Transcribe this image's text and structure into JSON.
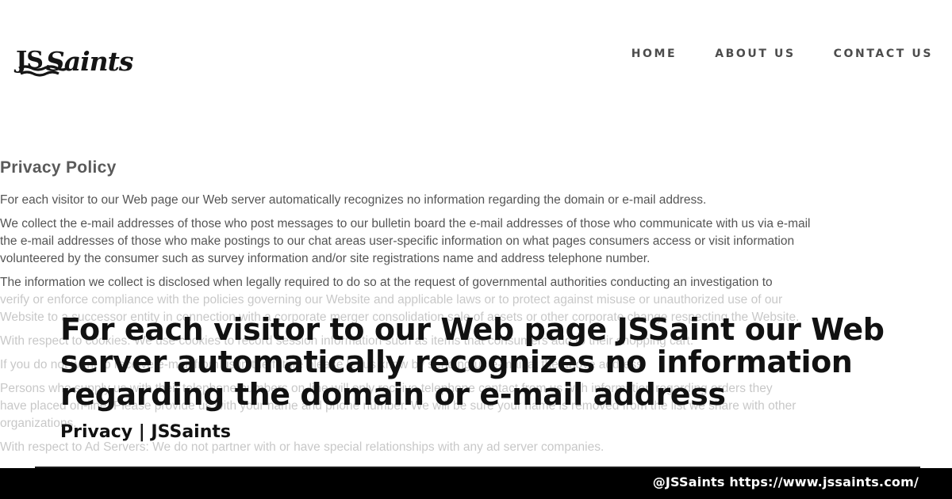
{
  "header": {
    "logo_js": "JS",
    "logo_saints": "Saints",
    "nav": [
      "HOME",
      "ABOUT US",
      "CONTACT US"
    ]
  },
  "policy": {
    "title": "Privacy Policy",
    "paragraphs": [
      [
        "For each visitor to our Web page our Web server automatically recognizes no information regarding the domain or e-mail address."
      ],
      [
        "We collect the e-mail addresses of those who post messages to our bulletin board the e-mail addresses of those who communicate with us via e-mail",
        "the e-mail addresses of those who make postings to our chat areas user-specific information on what pages consumers access or visit information",
        "volunteered by the consumer such as survey information and/or site registrations name and address telephone number."
      ],
      [
        "The information we collect is disclosed when legally required to do so at the request of governmental authorities conducting an investigation to",
        "verify or enforce compliance with the policies governing our Website and applicable laws or to protect against misuse or unauthorized use of our",
        "Website to a successor entity in connection with a corporate merger consolidation sale of assets or other corporate change respecting the Website."
      ],
      [
        "With respect to cookies: We use cookies to record session information such as items that consumers add to their shopping cart."
      ],
      [
        "If you do not want to receive e-mail from us in the future please let us know by sending us e-mail at the above address."
      ],
      [
        "Persons who supply us with their telephone numbers on-line will only receive telephone contact from us with information regarding orders they",
        "have placed on-line. Please provide us with your name and phone number. We will be sure your name is removed from the list we share with other",
        "organizations."
      ],
      [
        "With respect to Ad Servers: We do not partner with or have special relationships with any ad server companies."
      ]
    ]
  },
  "caption": {
    "title": "For each visitor to our Web page JSSaint our Web server automatically recognizes no information regarding the domain or e-mail address",
    "subtitle": "Privacy | JSSaints"
  },
  "footer": {
    "text": "@JSSaints https://www.jssaints.com/"
  }
}
